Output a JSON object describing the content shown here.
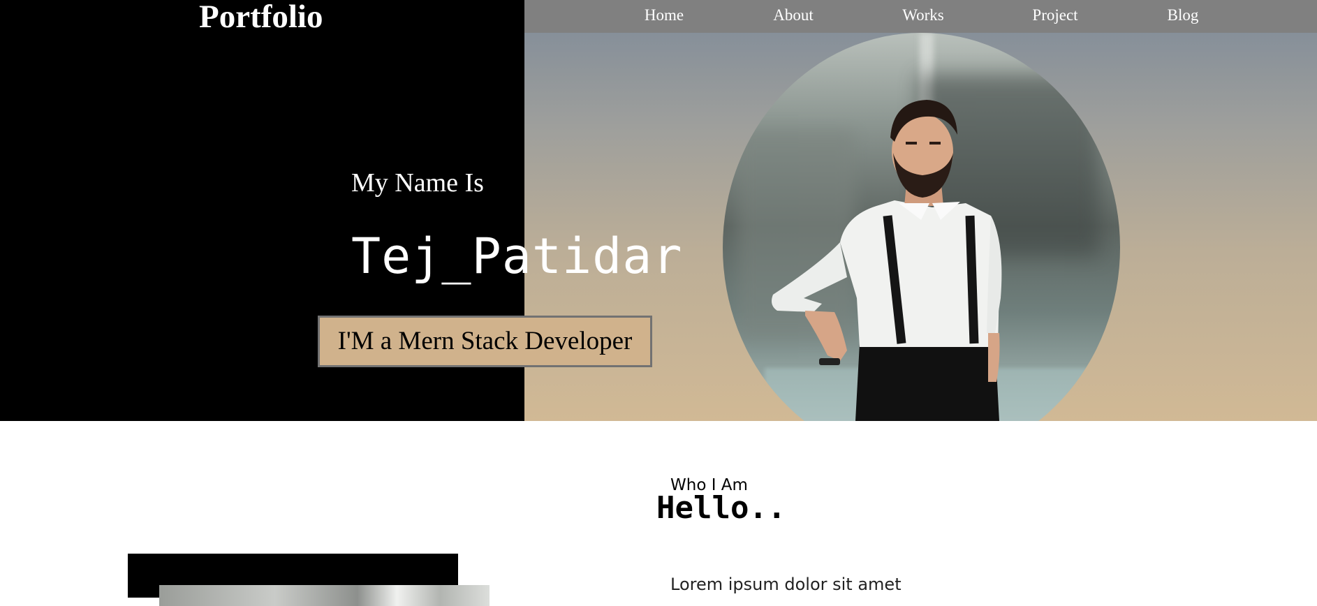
{
  "header": {
    "brand": "Portfolio",
    "nav": [
      {
        "label": "Home"
      },
      {
        "label": "About"
      },
      {
        "label": "Works"
      },
      {
        "label": "Project"
      },
      {
        "label": "Blog"
      }
    ]
  },
  "hero": {
    "intro": "My Name Is",
    "name": "Tej_Patidar",
    "role_button": "I'M a Mern Stack Developer"
  },
  "about": {
    "label": "Who I Am",
    "heading": "Hello..",
    "text": "Lorem ipsum dolor sit amet"
  },
  "colors": {
    "hero_left": "#000000",
    "nav_bg": "#808080",
    "role_button_bg": "#d0b28c",
    "role_button_border": "#727272"
  }
}
